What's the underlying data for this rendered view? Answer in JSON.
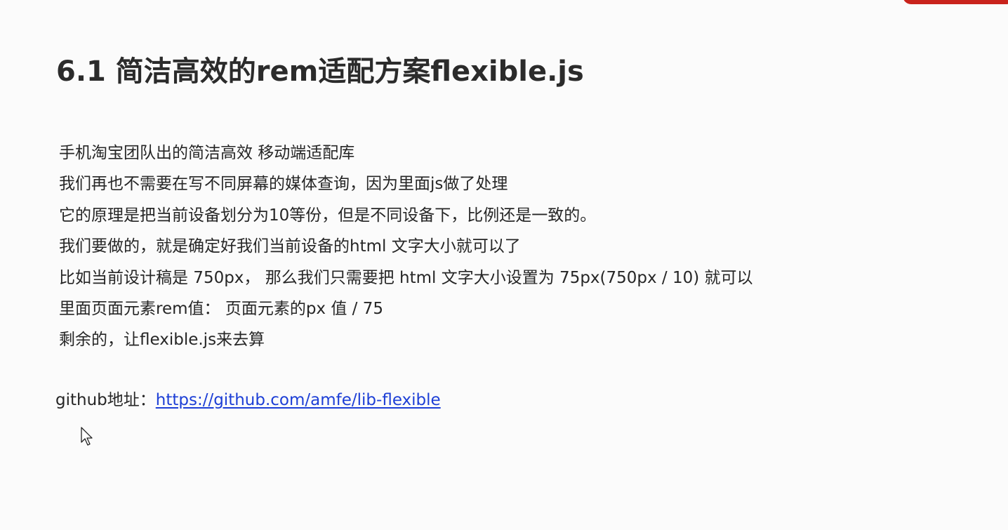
{
  "slide": {
    "title": "6.1 简洁高效的rem适配方案flexible.js",
    "lines": [
      "手机淘宝团队出的简洁高效 移动端适配库",
      "我们再也不需要在写不同屏幕的媒体查询，因为里面js做了处理",
      "它的原理是把当前设备划分为10等份，但是不同设备下，比例还是一致的。",
      "我们要做的，就是确定好我们当前设备的html 文字大小就可以了",
      "比如当前设计稿是 750px， 那么我们只需要把 html 文字大小设置为 75px(750px / 10) 就可以",
      "里面页面元素rem值： 页面元素的px 值 /  75",
      "剩余的，让flexible.js来去算"
    ],
    "github_label": "github地址：",
    "github_url_text": "https://github.com/amfe/lib-flexible"
  },
  "colors": {
    "background": "#fbfbfb",
    "text": "#262626",
    "link": "#1d3fd6",
    "accent": "#c9231c"
  },
  "icons": {
    "pointer": "mouse-pointer-icon"
  }
}
